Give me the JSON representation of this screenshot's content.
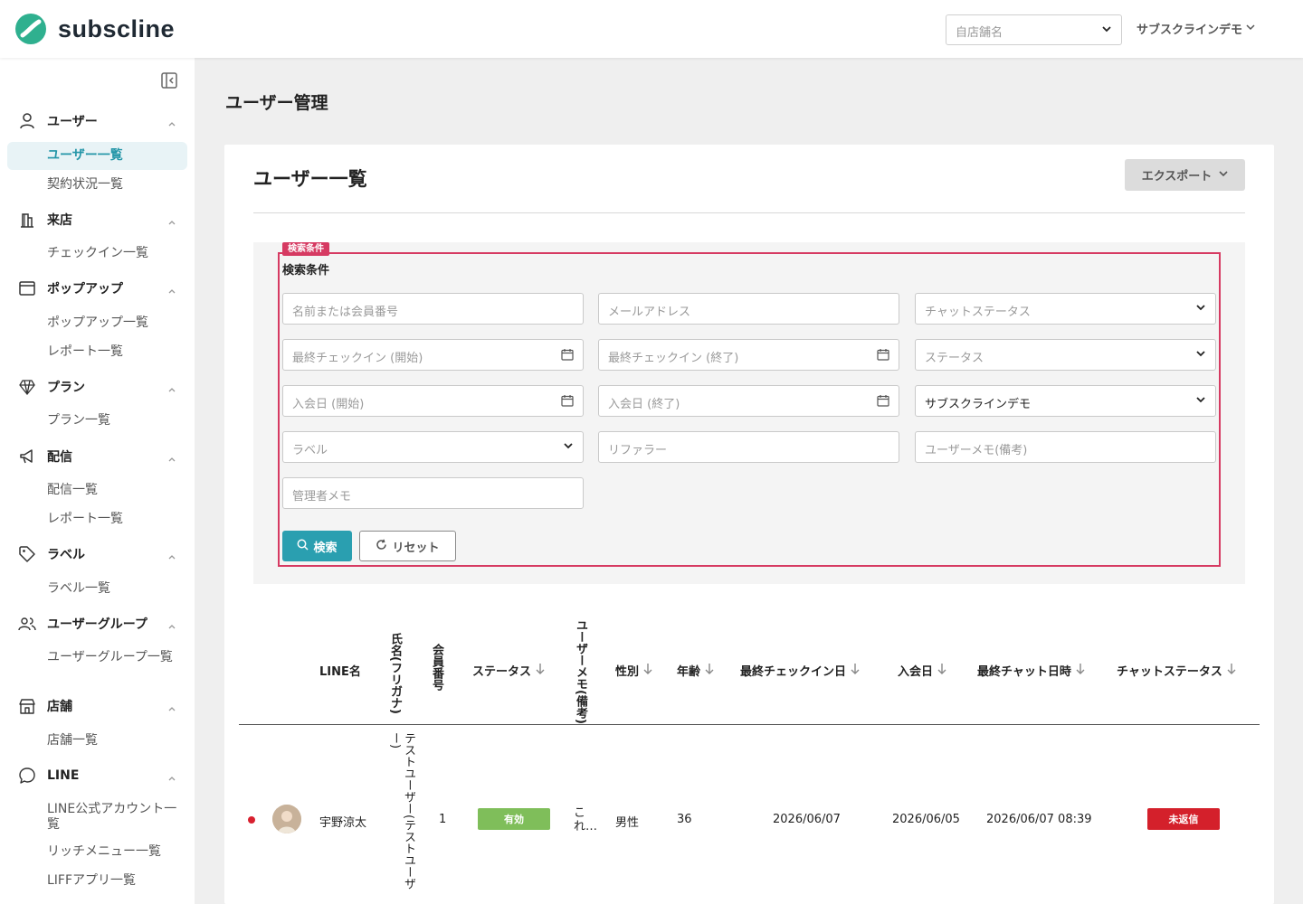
{
  "app": {
    "logo_text": "subscline",
    "brand_color": "#2a9fb0"
  },
  "header": {
    "store_placeholder": "自店舗名",
    "account_label": "サブスクラインデモ"
  },
  "sidebar": {
    "groups": [
      {
        "label": "ユーザー",
        "icon": "user-icon",
        "items": [
          "ユーザー一覧",
          "契約状況一覧"
        ]
      },
      {
        "label": "来店",
        "icon": "building-icon",
        "items": [
          "チェックイン一覧"
        ]
      },
      {
        "label": "ポップアップ",
        "icon": "window-icon",
        "items": [
          "ポップアップ一覧",
          "レポート一覧"
        ]
      },
      {
        "label": "プラン",
        "icon": "diamond-icon",
        "items": [
          "プラン一覧"
        ]
      },
      {
        "label": "配信",
        "icon": "megaphone-icon",
        "items": [
          "配信一覧",
          "レポート一覧"
        ]
      },
      {
        "label": "ラベル",
        "icon": "tag-icon",
        "items": [
          "ラベル一覧"
        ]
      },
      {
        "label": "ユーザーグループ",
        "icon": "users-icon",
        "items": [
          "ユーザーグループ一覧"
        ]
      },
      {
        "label": "店舗",
        "icon": "store-icon",
        "items": [
          "店舗一覧"
        ]
      },
      {
        "label": "LINE",
        "icon": "chat-icon",
        "items": [
          "LINE公式アカウント一覧",
          "リッチメニュー一覧",
          "LIFFアプリ一覧"
        ]
      }
    ],
    "active_item": "ユーザー一覧"
  },
  "page": {
    "title": "ユーザー管理",
    "card_title": "ユーザー一覧",
    "export_label": "エクスポート"
  },
  "search": {
    "tag": "検索条件",
    "heading": "検索条件",
    "fields": {
      "name": "名前または会員番号",
      "email": "メールアドレス",
      "chat_status": "チャットステータス",
      "checkin_start": "最終チェックイン (開始)",
      "checkin_end": "最終チェックイン (終了)",
      "status": "ステータス",
      "join_start": "入会日 (開始)",
      "join_end": "入会日 (終了)",
      "account": "サブスクラインデモ",
      "label": "ラベル",
      "referrer": "リファラー",
      "user_memo": "ユーザーメモ(備考)",
      "admin_memo": "管理者メモ"
    },
    "search_button": "検索",
    "reset_button": "リセット"
  },
  "table": {
    "headers": {
      "line_name": "LINE名",
      "kana": "氏名(フリガナ)",
      "member_no": "会員番号",
      "status": "ステータス",
      "memo": "ユーザーメモ(備考)",
      "gender": "性別",
      "age": "年齢",
      "last_checkin": "最終チェックイン日",
      "joined": "入会日",
      "last_chat": "最終チャット日時",
      "chat_status": "チャットステータス"
    },
    "rows": [
      {
        "line_name": "宇野涼太",
        "kana": "テストユーザー(テストユーザー)",
        "member_no": "1",
        "status": "有効",
        "memo": "これ…",
        "gender": "男性",
        "age": "36",
        "last_checkin": "2026/06/07",
        "joined": "2026/06/05",
        "last_chat": "2026/06/07 08:39",
        "chat_status": "未返信"
      }
    ]
  },
  "colors": {
    "status_active": "#7fbe5a",
    "chat_unreplied": "#d4202b",
    "highlight": "#d63a62"
  }
}
